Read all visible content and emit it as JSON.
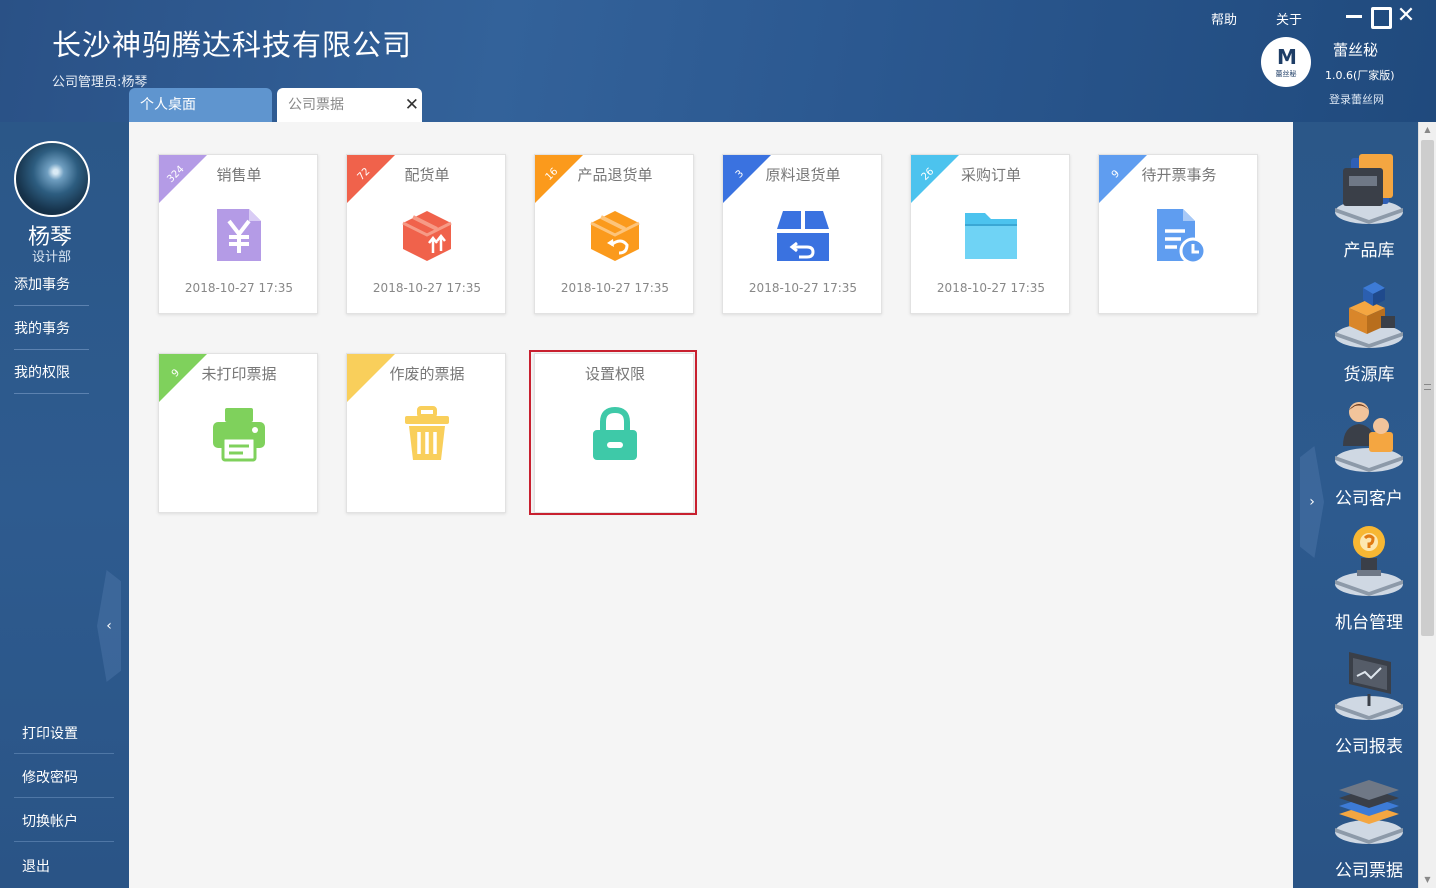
{
  "header": {
    "company": "长沙神驹腾达科技有限公司",
    "admin": "公司管理员:杨琴",
    "help": "帮助",
    "about": "关于",
    "minimize": "—",
    "maximize": "□",
    "close": "✕"
  },
  "brand": {
    "logo_mark": "M",
    "logo_text": "蕾丝秘",
    "name": "蕾丝秘",
    "version": "1.0.6(厂家版)",
    "login": "登录蕾丝网"
  },
  "tabs": [
    {
      "label": "个人桌面",
      "active": false
    },
    {
      "label": "公司票据",
      "active": true
    }
  ],
  "user": {
    "name": "杨琴",
    "dept": "设计部"
  },
  "left_nav": {
    "top": [
      "添加事务",
      "我的事务",
      "我的权限"
    ],
    "bottom": [
      "打印设置",
      "修改密码",
      "切换帐户",
      "退出"
    ],
    "collapse": "‹"
  },
  "tiles": [
    {
      "title": "销售单",
      "badge": "324",
      "time": "2018-10-27 17:35",
      "color": "#b49be6",
      "icon": "yen-document-icon"
    },
    {
      "title": "配货单",
      "badge": "72",
      "time": "2018-10-27 17:35",
      "color": "#f0624b",
      "icon": "shipping-box-icon"
    },
    {
      "title": "产品退货单",
      "badge": "16",
      "time": "2018-10-27 17:35",
      "color": "#fb9a1c",
      "icon": "return-box-icon"
    },
    {
      "title": "原料退货单",
      "badge": "3",
      "time": "2018-10-27 17:35",
      "color": "#3a72e0",
      "icon": "material-return-icon"
    },
    {
      "title": "采购订单",
      "badge": "26",
      "time": "2018-10-27 17:35",
      "color": "#4cc3ee",
      "icon": "folder-icon"
    },
    {
      "title": "待开票事务",
      "badge": "9",
      "time": "",
      "color": "#5f9df0",
      "icon": "pending-document-icon"
    },
    {
      "title": "未打印票据",
      "badge": "9",
      "time": "",
      "color": "#7fd15c",
      "icon": "printer-icon"
    },
    {
      "title": "作废的票据",
      "badge": "",
      "time": "",
      "color": "#f9cf5b",
      "icon": "trash-icon"
    },
    {
      "title": "设置权限",
      "badge": "",
      "time": "",
      "color": "#3ec9a8",
      "icon": "lock-icon"
    }
  ],
  "right_nav": [
    {
      "label": "产品库",
      "icon": "product-library-icon"
    },
    {
      "label": "货源库",
      "icon": "supply-library-icon"
    },
    {
      "label": "公司客户",
      "icon": "company-customers-icon"
    },
    {
      "label": "机台管理",
      "icon": "machine-management-icon"
    },
    {
      "label": "公司报表",
      "icon": "company-report-icon"
    },
    {
      "label": "公司票据",
      "icon": "company-invoice-icon"
    }
  ],
  "right_collapse": "›"
}
